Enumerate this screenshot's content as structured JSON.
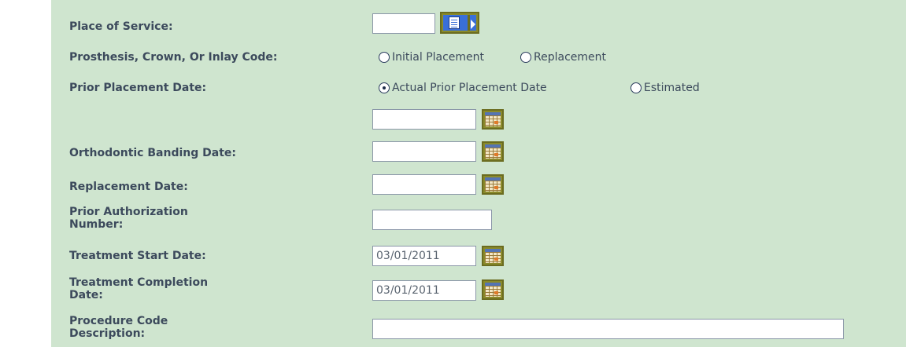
{
  "form": {
    "place_of_service": {
      "label": "Place of Service:",
      "value": ""
    },
    "prosthesis": {
      "label": "Prosthesis, Crown, Or Inlay Code:",
      "options": [
        {
          "label": "Initial Placement",
          "checked": false
        },
        {
          "label": "Replacement",
          "checked": false
        }
      ]
    },
    "prior_placement": {
      "label": "Prior Placement Date:",
      "options": [
        {
          "label": "Actual Prior Placement Date",
          "checked": true
        },
        {
          "label": "Estimated",
          "checked": false
        }
      ],
      "date_value": ""
    },
    "orthodontic_banding_date": {
      "label": "Orthodontic Banding Date:",
      "value": ""
    },
    "replacement_date": {
      "label": "Replacement Date:",
      "value": ""
    },
    "prior_authorization": {
      "label_line1": "Prior Authorization",
      "label_line2": "Number:",
      "value": ""
    },
    "treatment_start_date": {
      "label": "Treatment Start Date:",
      "value": "03/01/2011"
    },
    "treatment_completion_date": {
      "label_line1": "Treatment Completion",
      "label_line2": "Date:",
      "value": "03/01/2011"
    },
    "procedure_code_description": {
      "label_line1": "Procedure Code",
      "label_line2": "Description:",
      "value": ""
    }
  },
  "icons": {
    "lookup": "lookup-list-icon",
    "calendar": "calendar-icon"
  }
}
